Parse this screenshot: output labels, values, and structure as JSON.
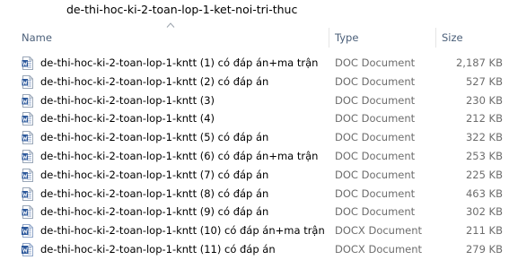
{
  "folder_title": "de-thi-hoc-ki-2-toan-lop-1-ket-noi-tri-thuc",
  "columns": {
    "name": "Name",
    "type": "Type",
    "size": "Size"
  },
  "files": [
    {
      "name": "de-thi-hoc-ki-2-toan-lop-1-kntt (1) có đáp án+ma trận",
      "type": "DOC Document",
      "size": "2,187 KB",
      "icon": "word-doc-icon"
    },
    {
      "name": "de-thi-hoc-ki-2-toan-lop-1-kntt (2) có đáp án",
      "type": "DOC Document",
      "size": "527 KB",
      "icon": "word-doc-icon"
    },
    {
      "name": "de-thi-hoc-ki-2-toan-lop-1-kntt (3)",
      "type": "DOC Document",
      "size": "230 KB",
      "icon": "word-doc-icon"
    },
    {
      "name": "de-thi-hoc-ki-2-toan-lop-1-kntt (4)",
      "type": "DOC Document",
      "size": "212 KB",
      "icon": "word-doc-icon"
    },
    {
      "name": "de-thi-hoc-ki-2-toan-lop-1-kntt (5) có đáp án",
      "type": "DOC Document",
      "size": "322 KB",
      "icon": "word-doc-icon"
    },
    {
      "name": "de-thi-hoc-ki-2-toan-lop-1-kntt (6) có đáp án+ma trận",
      "type": "DOC Document",
      "size": "253 KB",
      "icon": "word-doc-icon"
    },
    {
      "name": "de-thi-hoc-ki-2-toan-lop-1-kntt (7) có đáp án",
      "type": "DOC Document",
      "size": "225 KB",
      "icon": "word-doc-icon"
    },
    {
      "name": "de-thi-hoc-ki-2-toan-lop-1-kntt (8) có đáp án",
      "type": "DOC Document",
      "size": "463 KB",
      "icon": "word-doc-icon"
    },
    {
      "name": "de-thi-hoc-ki-2-toan-lop-1-kntt (9) có đáp án",
      "type": "DOC Document",
      "size": "302 KB",
      "icon": "word-doc-icon"
    },
    {
      "name": "de-thi-hoc-ki-2-toan-lop-1-kntt (10) có đáp án+ma trận",
      "type": "DOCX Document",
      "size": "211 KB",
      "icon": "word-docx-icon"
    },
    {
      "name": "de-thi-hoc-ki-2-toan-lop-1-kntt (11) có đáp án",
      "type": "DOCX Document",
      "size": "279 KB",
      "icon": "word-docx-icon"
    }
  ],
  "colors": {
    "header_text": "#4c607a",
    "secondary_text": "#6d6d6d",
    "word_blue": "#2b579a"
  }
}
